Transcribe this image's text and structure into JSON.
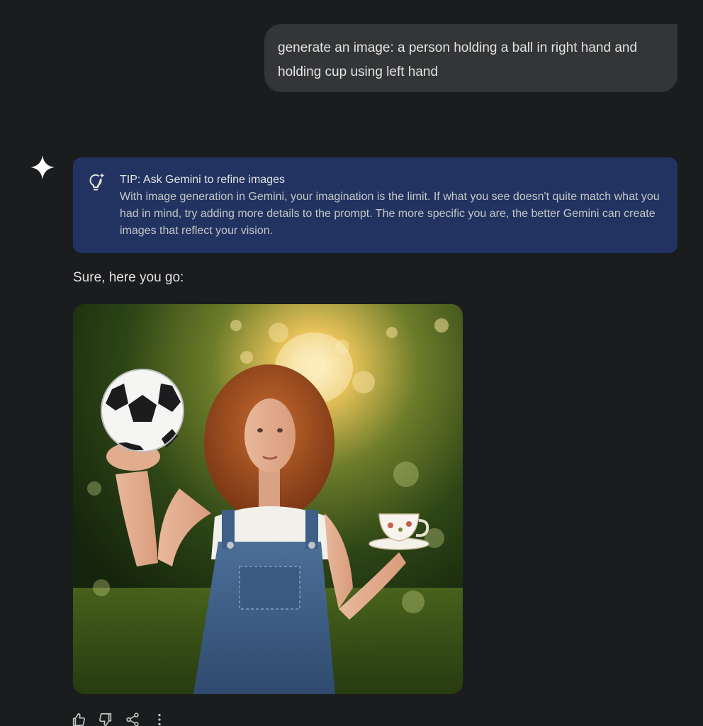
{
  "user_message": {
    "line1": "generate an image: a person holding a ball in right hand and",
    "line2": "holding cup using left hand"
  },
  "tip": {
    "title": "TIP: Ask Gemini to refine images",
    "body": "With image generation in Gemini, your imagination is the limit. If what you see doesn't quite match what you had in mind, try adding more details to the prompt. The more specific you are, the better Gemini can create images that reflect your vision.",
    "icon": "lightbulb-sparkle-icon"
  },
  "response": {
    "text": "Sure, here you go:"
  },
  "actions": {
    "icons": [
      "thumbs-up-icon",
      "thumbs-down-icon",
      "share-icon",
      "more-vert-icon"
    ]
  },
  "colors": {
    "background": "#1b1c1e",
    "user_bubble": "#333537",
    "tip_card": "#223361",
    "text_primary": "#e3e3e3",
    "text_secondary": "#c4c7c5"
  }
}
